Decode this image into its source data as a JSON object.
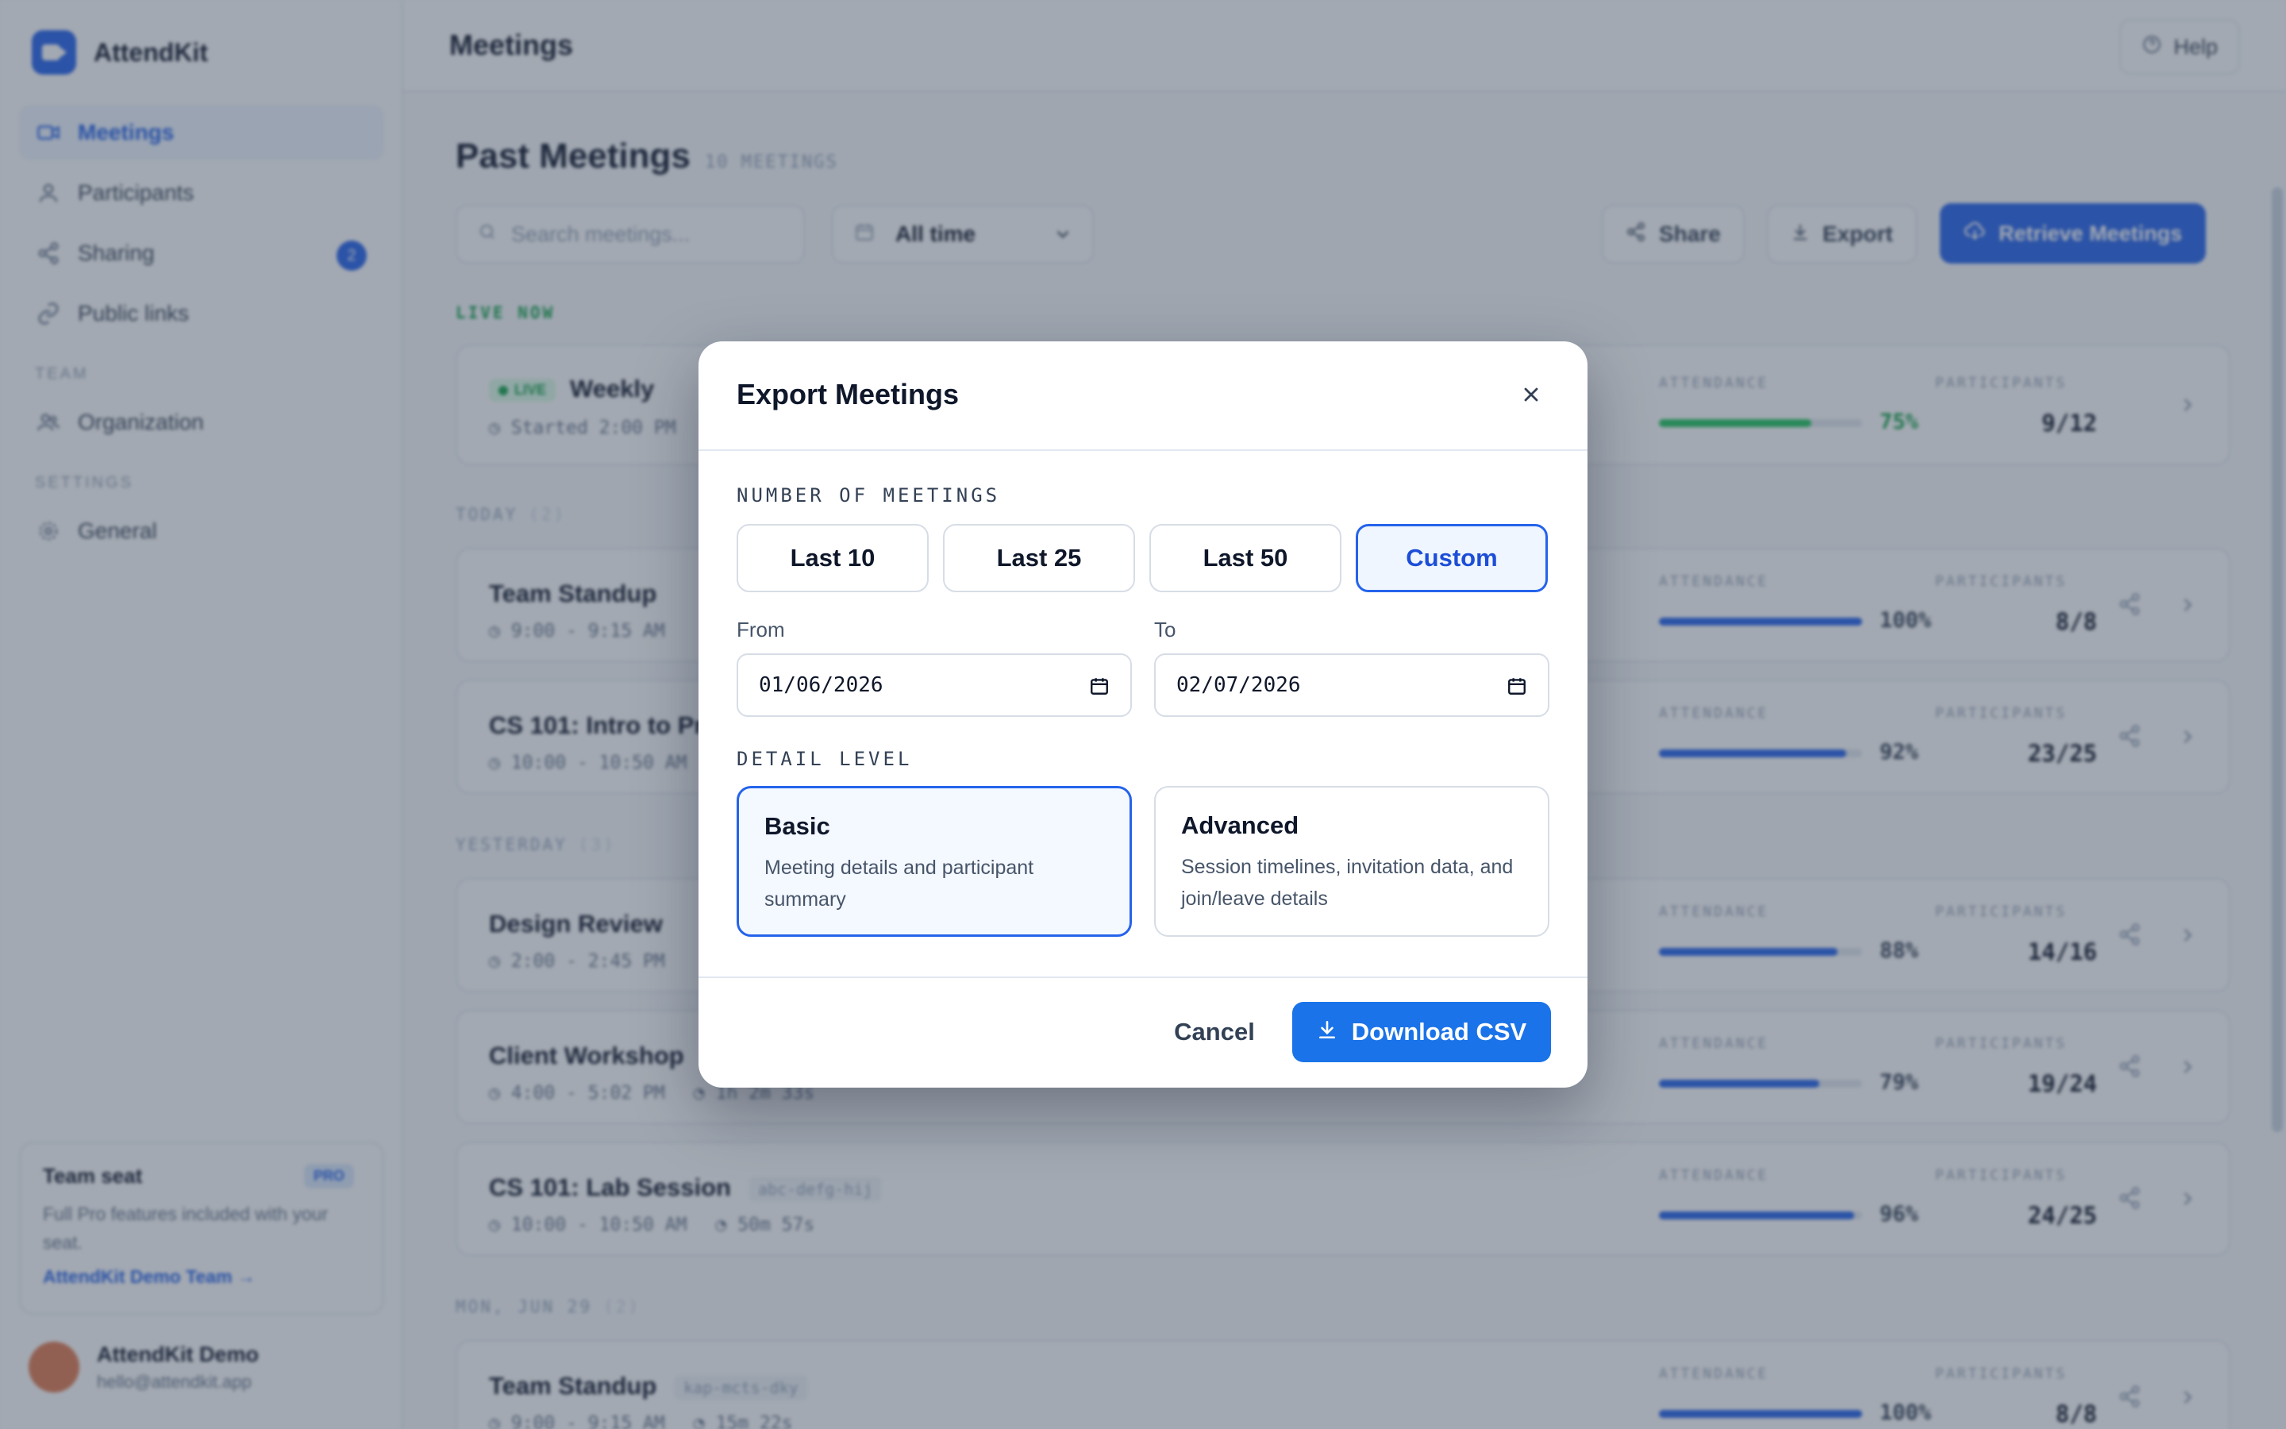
{
  "app": {
    "name": "AttendKit",
    "topbar_title": "Meetings",
    "help_label": "Help"
  },
  "sidebar": {
    "items": [
      {
        "label": "Meetings",
        "icon": "video-icon",
        "active": true
      },
      {
        "label": "Participants",
        "icon": "person-icon"
      },
      {
        "label": "Sharing",
        "icon": "share-icon",
        "badge": "2"
      },
      {
        "label": "Public links",
        "icon": "link-icon"
      }
    ],
    "team_section": "TEAM",
    "team_items": [
      {
        "label": "Organization",
        "icon": "people-icon"
      }
    ],
    "settings_section": "SETTINGS",
    "settings_items": [
      {
        "label": "General",
        "icon": "gear-icon"
      }
    ],
    "seat_card": {
      "title": "Team seat",
      "badge": "PRO",
      "description": "Full Pro features included with your seat.",
      "link": "AttendKit Demo Team →"
    },
    "user": {
      "name": "AttendKit Demo",
      "email": "hello@attendkit.app"
    }
  },
  "main": {
    "title": "Past Meetings",
    "count": "10 MEETINGS",
    "search_placeholder": "Search meetings...",
    "time_filter": "All time",
    "share_label": "Share",
    "export_label": "Export",
    "retrieve_label": "Retrieve Meetings",
    "attendance_label": "ATTENDANCE",
    "participants_label": "PARTICIPANTS",
    "groups": [
      {
        "label": "LIVE NOW",
        "count": ""
      },
      {
        "label": "TODAY",
        "count": "(2)"
      },
      {
        "label": "YESTERDAY",
        "count": "(3)"
      },
      {
        "label": "MON, JUN 29",
        "count": "(2)"
      }
    ],
    "meetings": [
      {
        "title": "Weekly",
        "live": "LIVE",
        "meta": "Started 2:00 PM",
        "attendance": "75%",
        "attendance_value": 0.75,
        "participants": "9/12"
      },
      {
        "title": "Team Standup",
        "meta": "9:00 - 9:15 AM",
        "attendance": "100%",
        "attendance_value": 1.0,
        "participants": "8/8"
      },
      {
        "title": "CS 101: Intro to Pr",
        "meta": "10:00 - 10:50 AM",
        "attendance": "92%",
        "attendance_value": 0.92,
        "participants": "23/25"
      },
      {
        "title": "Design Review",
        "meta": "2:00 - 2:45 PM",
        "attendance": "88%",
        "attendance_value": 0.88,
        "participants": "14/16"
      },
      {
        "title": "Client Workshop",
        "meta": "4:00 - 5:02 PM",
        "extra": "1h 2m 33s",
        "attendance": "79%",
        "attendance_value": 0.79,
        "participants": "19/24"
      },
      {
        "title": "CS 101: Lab Session",
        "code": "abc-defg-hij",
        "meta": "10:00 - 10:50 AM",
        "extra": "50m 57s",
        "attendance": "96%",
        "attendance_value": 0.96,
        "participants": "24/25"
      },
      {
        "title": "Team Standup",
        "code": "kap-mcts-dky",
        "meta": "9:00 - 9:15 AM",
        "extra": "15m 22s",
        "attendance": "100%",
        "attendance_value": 1.0,
        "participants": "8/8"
      }
    ]
  },
  "modal": {
    "title": "Export Meetings",
    "number_label": "NUMBER OF MEETINGS",
    "count_options": [
      "Last 10",
      "Last 25",
      "Last 50",
      "Custom"
    ],
    "selected_count": "Custom",
    "from_label": "From",
    "from_value": "01/06/2026",
    "to_label": "To",
    "to_value": "02/07/2026",
    "detail_label": "DETAIL LEVEL",
    "detail_options": [
      {
        "title": "Basic",
        "description": "Meeting details and participant summary",
        "selected": true
      },
      {
        "title": "Advanced",
        "description": "Session timelines, invitation data, and join/leave details",
        "selected": false
      }
    ],
    "cancel_label": "Cancel",
    "download_label": "Download CSV"
  },
  "colors": {
    "accent": "#2563eb",
    "download_button": "#1a73e8",
    "live_green": "#16a34a"
  }
}
